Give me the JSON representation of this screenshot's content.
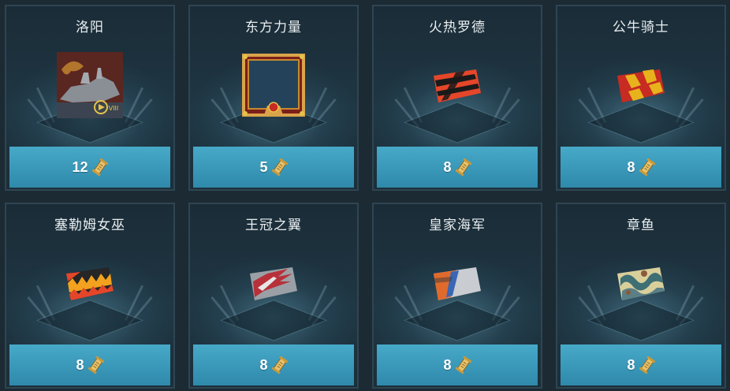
{
  "items": [
    {
      "title": "洛阳",
      "price": "12",
      "thumb": "ship-portrait-icon",
      "colors": [
        "#6b2e24",
        "#8a8f96"
      ]
    },
    {
      "title": "东方力量",
      "price": "5",
      "thumb": "ornate-frame-icon",
      "colors": [
        "#c7892f",
        "#7c1f1a"
      ]
    },
    {
      "title": "火热罗德",
      "price": "8",
      "thumb": "camouflage-flag-icon",
      "colors": [
        "#e5462a",
        "#1a1a1a"
      ]
    },
    {
      "title": "公牛骑士",
      "price": "8",
      "thumb": "camouflage-flag-icon",
      "colors": [
        "#e8b21d",
        "#c72b22"
      ]
    },
    {
      "title": "塞勒姆女巫",
      "price": "8",
      "thumb": "camouflage-flag-icon",
      "colors": [
        "#f2a21e",
        "#262626"
      ]
    },
    {
      "title": "王冠之翼",
      "price": "8",
      "thumb": "camouflage-flag-icon",
      "colors": [
        "#b8313a",
        "#9aa0a6"
      ]
    },
    {
      "title": "皇家海军",
      "price": "8",
      "thumb": "camouflage-flag-icon",
      "colors": [
        "#e06a2c",
        "#3a66b3"
      ]
    },
    {
      "title": "章鱼",
      "price": "8",
      "thumb": "camouflage-flag-icon",
      "colors": [
        "#d9cf9b",
        "#3d6f74"
      ]
    }
  ],
  "currency_icon": "scroll-currency-icon",
  "accent": "#3f9dbf"
}
